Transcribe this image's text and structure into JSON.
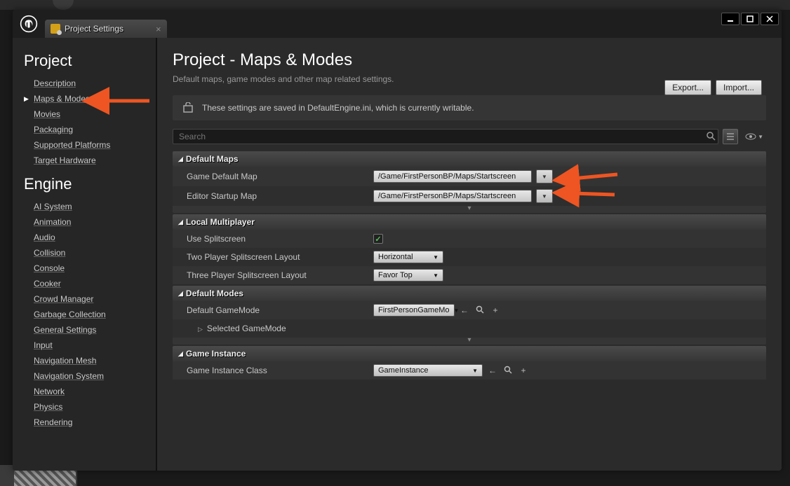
{
  "tab": {
    "title": "Project Settings"
  },
  "sidebar": {
    "section1": {
      "title": "Project",
      "items": [
        "Description",
        "Maps & Modes",
        "Movies",
        "Packaging",
        "Supported Platforms",
        "Target Hardware"
      ]
    },
    "section2": {
      "title": "Engine",
      "items": [
        "AI System",
        "Animation",
        "Audio",
        "Collision",
        "Console",
        "Cooker",
        "Crowd Manager",
        "Garbage Collection",
        "General Settings",
        "Input",
        "Navigation Mesh",
        "Navigation System",
        "Network",
        "Physics",
        "Rendering"
      ]
    }
  },
  "page": {
    "title": "Project - Maps & Modes",
    "subtitle": "Default maps, game modes and other map related settings.",
    "export": "Export...",
    "import": "Import..."
  },
  "infobar": {
    "text": "These settings are saved in DefaultEngine.ini, which is currently writable."
  },
  "search": {
    "placeholder": "Search"
  },
  "sections": {
    "defaultMaps": {
      "header": "Default Maps",
      "gameDefault": {
        "label": "Game Default Map",
        "value": "/Game/FirstPersonBP/Maps/Startscreen"
      },
      "editorStartup": {
        "label": "Editor Startup Map",
        "value": "/Game/FirstPersonBP/Maps/Startscreen"
      }
    },
    "localMulti": {
      "header": "Local Multiplayer",
      "useSplit": {
        "label": "Use Splitscreen",
        "value": true
      },
      "twoPlayer": {
        "label": "Two Player Splitscreen Layout",
        "value": "Horizontal"
      },
      "threePlayer": {
        "label": "Three Player Splitscreen Layout",
        "value": "Favor Top"
      }
    },
    "defaultModes": {
      "header": "Default Modes",
      "defaultGameMode": {
        "label": "Default GameMode",
        "value": "FirstPersonGameMo"
      },
      "selectedGameMode": {
        "label": "Selected GameMode"
      }
    },
    "gameInstance": {
      "header": "Game Instance",
      "class": {
        "label": "Game Instance Class",
        "value": "GameInstance"
      }
    }
  }
}
